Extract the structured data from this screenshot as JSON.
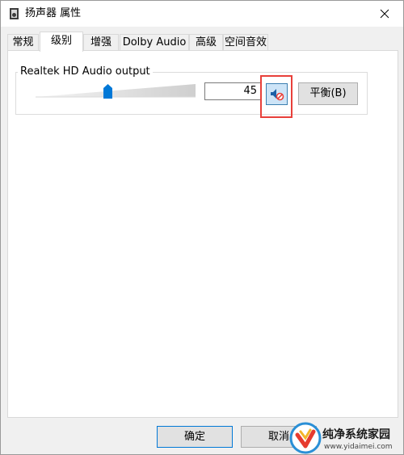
{
  "window": {
    "title": "扬声器 属性"
  },
  "tabs": [
    {
      "label": "常规",
      "active": false
    },
    {
      "label": "级别",
      "active": true
    },
    {
      "label": "增强",
      "active": false
    },
    {
      "label": "Dolby Audio",
      "active": false
    },
    {
      "label": "高级",
      "active": false
    },
    {
      "label": "空间音效",
      "active": false
    }
  ],
  "levels": {
    "device_name": "Realtek HD Audio output",
    "volume_value": "45",
    "volume_level": 0.45,
    "mute_icon": "speaker-muted-icon",
    "balance_label": "平衡(B)"
  },
  "footer": {
    "ok_label": "确定",
    "cancel_label": "取消"
  },
  "watermark": {
    "text": "纯净系统家园",
    "url": "www.yidaimei.com"
  },
  "colors": {
    "highlight": "#e8403a",
    "thumb": "#0078d7",
    "mute_button_bg": "#cde4f7"
  }
}
